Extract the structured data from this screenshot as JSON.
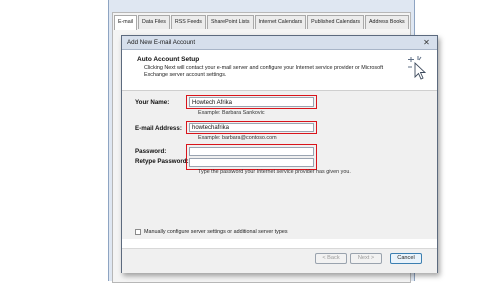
{
  "background_window": {
    "tabs": [
      "E-mail",
      "Data Files",
      "RSS Feeds",
      "SharePoint Lists",
      "Internet Calendars",
      "Published Calendars",
      "Address Books"
    ]
  },
  "dialog": {
    "title": "Add New E-mail Account",
    "close_glyph": "✕",
    "header": {
      "title": "Auto Account Setup",
      "description": "Clicking Next will contact your e-mail server and configure your Internet service provider or Microsoft Exchange server account settings."
    },
    "form": {
      "name_label": "Your Name:",
      "name_value": "Howtech Afrika",
      "name_example": "Example: Barbara Sankovic",
      "email_label": "E-mail Address:",
      "email_value": "howtechafrika",
      "email_example": "Example: barbara@contoso.com",
      "password_label": "Password:",
      "password_value": "",
      "retype_label": "Retype Password:",
      "retype_value": "",
      "password_hint": "Type the password your Internet service provider has given you."
    },
    "manual_config_label": "Manually configure server settings or additional server types",
    "buttons": {
      "back": "< Back",
      "next": "Next >",
      "cancel": "Cancel"
    }
  },
  "colors": {
    "highlight": "#d9141b",
    "titlebar": "#d6dfec"
  },
  "icons": [
    "close-icon",
    "cursor-sparkle-icon",
    "checkbox"
  ]
}
